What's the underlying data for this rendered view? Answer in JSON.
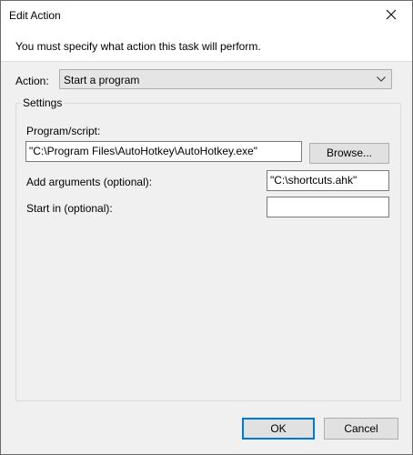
{
  "window": {
    "title": "Edit Action"
  },
  "banner": {
    "text": "You must specify what action this task will perform."
  },
  "action": {
    "label": "Action:",
    "selected": "Start a program"
  },
  "settings": {
    "legend": "Settings",
    "program_label": "Program/script:",
    "program_value": "\"C:\\Program Files\\AutoHotkey\\AutoHotkey.exe\"",
    "browse_label": "Browse...",
    "arguments_label": "Add arguments (optional):",
    "arguments_value": "\"C:\\shortcuts.ahk\"",
    "start_in_label": "Start in (optional):",
    "start_in_value": ""
  },
  "buttons": {
    "ok": "OK",
    "cancel": "Cancel"
  },
  "icons": {
    "close": "close-icon",
    "dropdown": "chevron-down-icon"
  },
  "colors": {
    "accent": "#0078d7"
  }
}
